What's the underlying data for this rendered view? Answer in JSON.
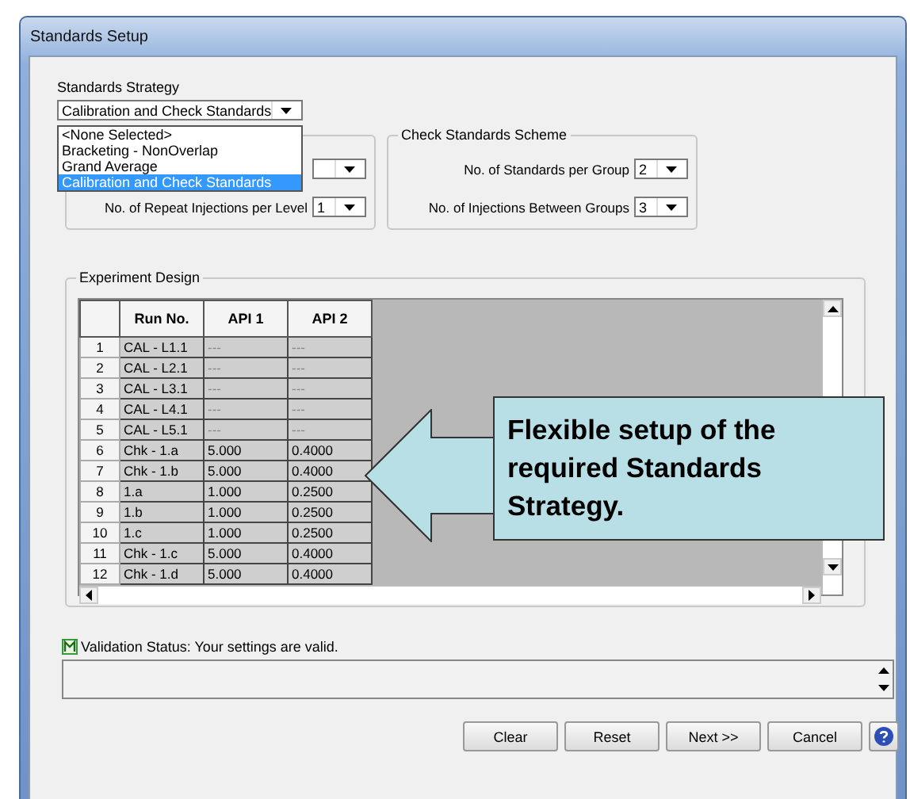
{
  "window": {
    "title": "Standards Setup"
  },
  "strategy": {
    "label": "Standards Strategy",
    "value": "Calibration and Check Standards",
    "options": [
      {
        "label": "<None Selected>",
        "selected": false
      },
      {
        "label": "Bracketing - NonOverlap",
        "selected": false
      },
      {
        "label": "Grand Average",
        "selected": false
      },
      {
        "label": "Calibration and Check Standards",
        "selected": true
      }
    ]
  },
  "left_group": {
    "fields": [
      {
        "label": "No. of Repeat Injections per Level",
        "value": "1"
      }
    ]
  },
  "check_scheme": {
    "title": "Check Standards Scheme",
    "fields": [
      {
        "label": "No. of Standards per Group",
        "value": "2"
      },
      {
        "label": "No. of Injections Between Groups",
        "value": "3"
      }
    ]
  },
  "experiment": {
    "title": "Experiment Design",
    "columns": [
      "Run No.",
      "API 1",
      "API 2"
    ],
    "rows": [
      {
        "num": "1",
        "cells": [
          "CAL - L1.1",
          "---",
          "---"
        ]
      },
      {
        "num": "2",
        "cells": [
          "CAL - L2.1",
          "---",
          "---"
        ]
      },
      {
        "num": "3",
        "cells": [
          "CAL - L3.1",
          "---",
          "---"
        ]
      },
      {
        "num": "4",
        "cells": [
          "CAL - L4.1",
          "---",
          "---"
        ]
      },
      {
        "num": "5",
        "cells": [
          "CAL - L5.1",
          "---",
          "---"
        ]
      },
      {
        "num": "6",
        "cells": [
          "Chk - 1.a",
          "5.000",
          "0.4000"
        ]
      },
      {
        "num": "7",
        "cells": [
          "Chk - 1.b",
          "5.000",
          "0.4000"
        ]
      },
      {
        "num": "8",
        "cells": [
          "1.a",
          "1.000",
          "0.2500"
        ]
      },
      {
        "num": "9",
        "cells": [
          "1.b",
          "1.000",
          "0.2500"
        ]
      },
      {
        "num": "10",
        "cells": [
          "1.c",
          "1.000",
          "0.2500"
        ]
      },
      {
        "num": "11",
        "cells": [
          "Chk - 1.c",
          "5.000",
          "0.4000"
        ]
      },
      {
        "num": "12",
        "cells": [
          "Chk - 1.d",
          "5.000",
          "0.4000"
        ]
      }
    ]
  },
  "validation": {
    "text": "Validation Status: Your settings are valid."
  },
  "buttons": [
    "Clear",
    "Reset",
    "Next >>",
    "Cancel"
  ],
  "callout": {
    "text": "Flexible setup of the required Standards Strategy."
  }
}
